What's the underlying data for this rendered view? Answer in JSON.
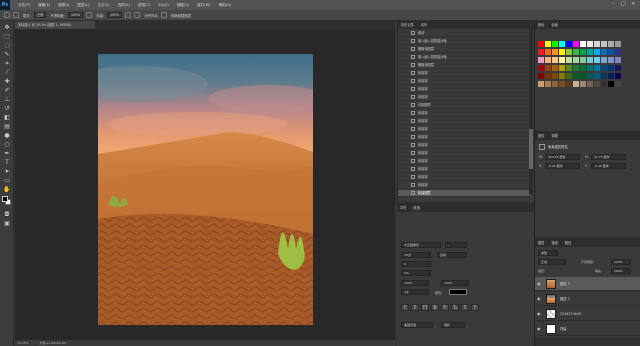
{
  "app": {
    "logo": "Ps"
  },
  "menubar": {
    "items": [
      "文件(F)",
      "编辑(E)",
      "图像(I)",
      "图层(L)",
      "文字(Y)",
      "选择(S)",
      "滤镜(T)",
      "3D(D)",
      "视图(V)",
      "窗口(W)",
      "帮助(H)"
    ]
  },
  "optbar": {
    "mode_label": "模式:",
    "mode_value": "正常",
    "opacity_label": "不透明度:",
    "opacity_value": "100%",
    "flow_label": "流量:",
    "flow_value": "100%",
    "sample_label": "对齐样本",
    "extra": "忽略调整图层"
  },
  "document": {
    "tab_title": "未标题-1 @ 33.3% (图层 1, RGB/8)"
  },
  "statusbar": {
    "zoom": "33.33%",
    "doc": "文档:11.4M/55.7M"
  },
  "history": {
    "tabs": [
      "历史记录",
      "动作"
    ],
    "items": [
      "移动",
      "置入嵌入的智能对象",
      "栅格化图层",
      "置入嵌入的智能对象",
      "栅格化图层",
      "橡皮擦",
      "橡皮擦",
      "橡皮擦",
      "橡皮擦",
      "仿制图章",
      "橡皮擦",
      "橡皮擦",
      "橡皮擦",
      "橡皮擦",
      "橡皮擦",
      "橡皮擦",
      "橡皮擦",
      "橡皮擦",
      "橡皮擦",
      "橡皮擦",
      "新建图层"
    ]
  },
  "swatches": {
    "tabs": [
      "颜色",
      "色板"
    ]
  },
  "properties": {
    "tabs": [
      "属性",
      "调整"
    ],
    "title": "像素图层属性",
    "w_label": "W:",
    "w_value": "423.45 厘米",
    "h_label": "H:",
    "h_value": "11.73 厘米",
    "x_label": "X:",
    "x_value": "-0.26 厘米",
    "y_label": "Y:",
    "y_value": "-2.45 厘米"
  },
  "character": {
    "tabs": [
      "字符",
      "段落"
    ],
    "font": "方正粗黑宋",
    "style": "-",
    "size": "18点",
    "leading": "自动",
    "tracking": "0",
    "kerning": "0%",
    "scale_v": "100%",
    "scale_h": "100%",
    "baseline": "0点",
    "color_label": "颜色:",
    "lang": "美国英语",
    "aa": "锐利",
    "tbtns": [
      "T",
      "T",
      "TT",
      "Tr",
      "T¹",
      "T₁",
      "T",
      "T"
    ]
  },
  "layers": {
    "tabs": [
      "图层",
      "通道",
      "路径"
    ],
    "kind": "类型",
    "blend": "正常",
    "opacity_label": "不透明度:",
    "opacity": "100%",
    "lock_label": "锁定:",
    "fill_label": "填充:",
    "fill": "100%",
    "rows": [
      {
        "name": "图层 3",
        "selected": true
      },
      {
        "name": "图层 2",
        "selected": false
      },
      {
        "name": "1234374444",
        "selected": false
      },
      {
        "name": "背景",
        "selected": false
      }
    ]
  },
  "colors": {
    "accent": "#31a8ff"
  }
}
